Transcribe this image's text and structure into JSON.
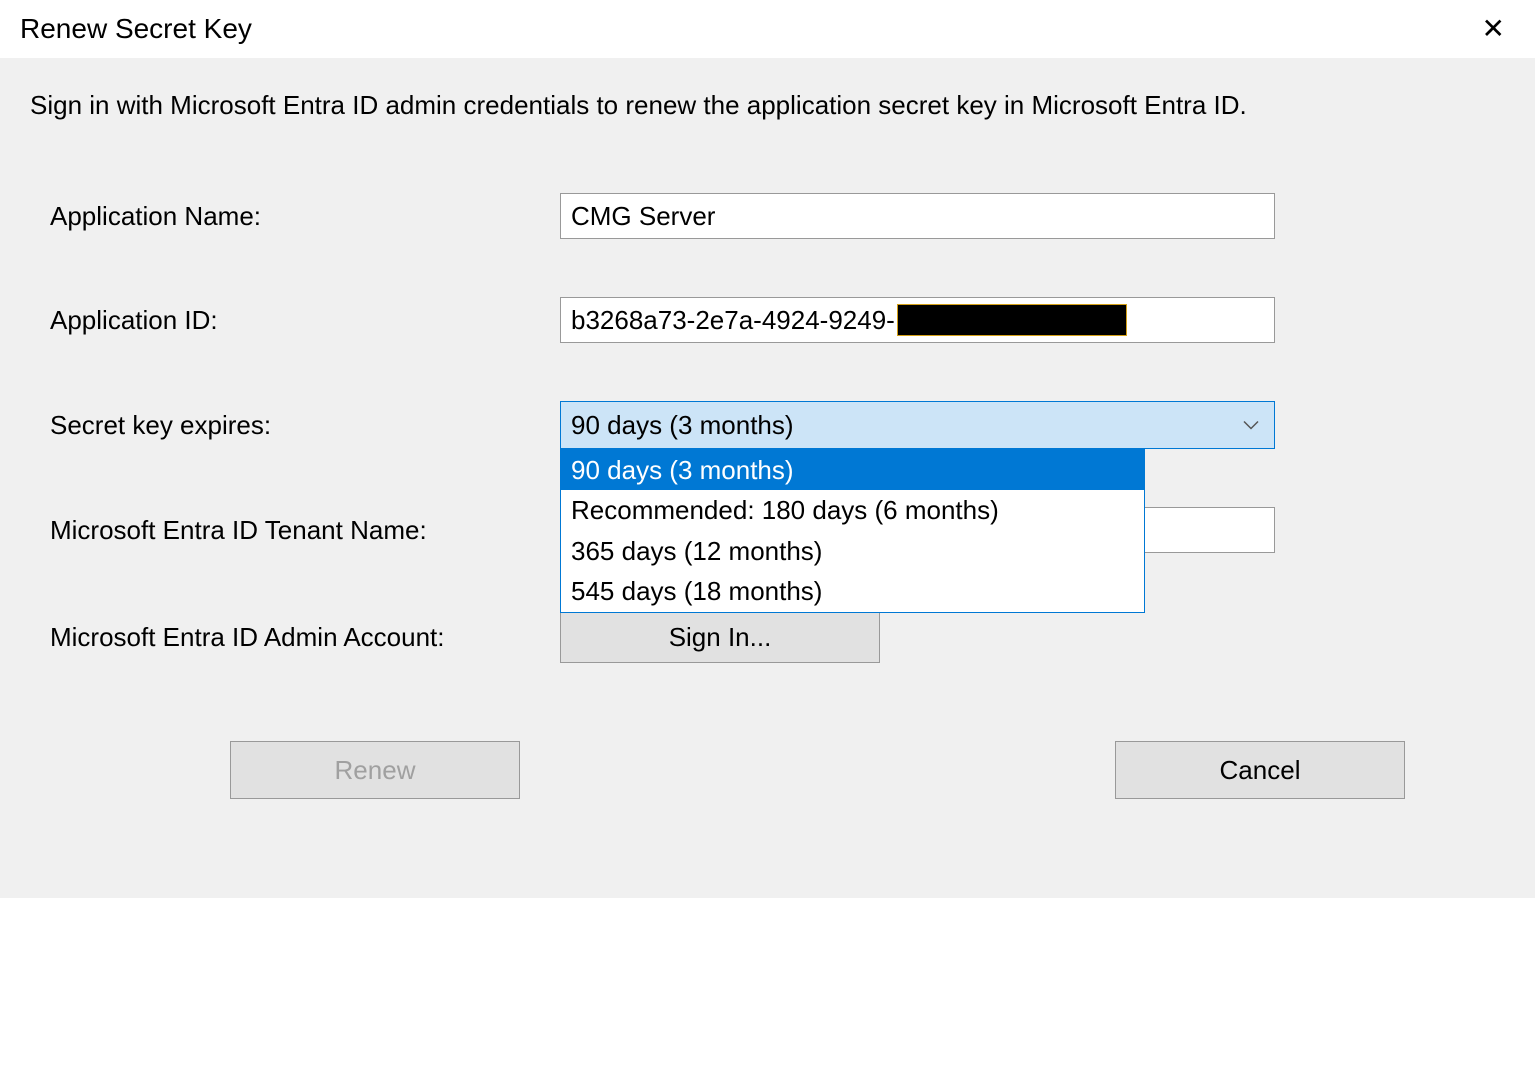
{
  "dialog": {
    "title": "Renew Secret Key",
    "description": "Sign in with Microsoft Entra ID admin credentials to renew the application secret key in Microsoft Entra ID."
  },
  "form": {
    "app_name": {
      "label": "Application Name:",
      "value": "CMG Server"
    },
    "app_id": {
      "label": "Application ID:",
      "value": "b3268a73-2e7a-4924-9249-"
    },
    "expires": {
      "label": "Secret key expires:",
      "selected": "90 days (3 months)",
      "options": [
        "90 days (3 months)",
        "Recommended: 180 days (6 months)",
        "365 days (12 months)",
        "545 days (18 months)"
      ]
    },
    "tenant": {
      "label": "Microsoft Entra ID Tenant Name:",
      "value": ""
    },
    "admin": {
      "label": "Microsoft Entra ID Admin Account:",
      "button": "Sign In..."
    }
  },
  "buttons": {
    "renew": "Renew",
    "cancel": "Cancel"
  }
}
